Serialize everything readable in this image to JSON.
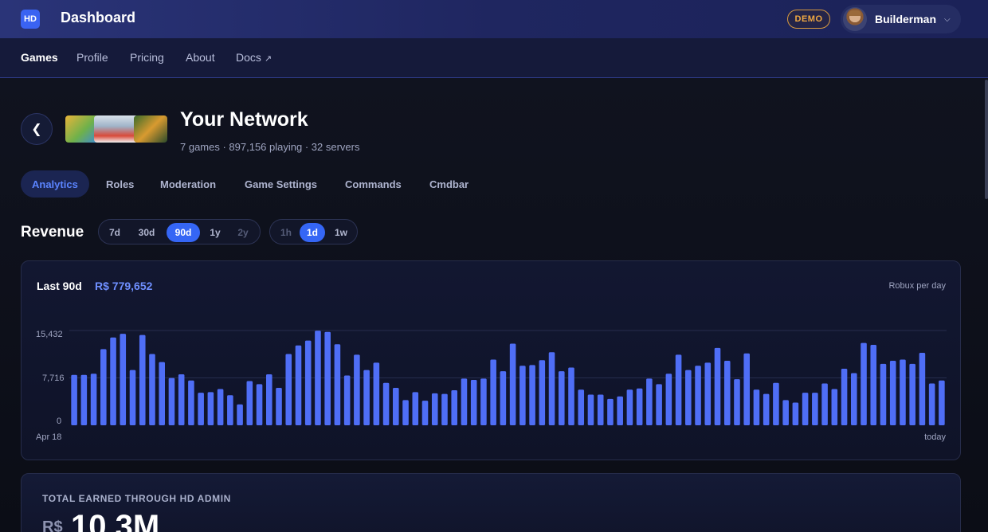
{
  "header": {
    "logo_text": "HD",
    "title": "Dashboard",
    "demo_badge": "DEMO",
    "username": "Builderman"
  },
  "nav": {
    "items": [
      {
        "label": "Games",
        "active": true
      },
      {
        "label": "Profile"
      },
      {
        "label": "Pricing"
      },
      {
        "label": "About"
      },
      {
        "label": "Docs",
        "external": true
      }
    ]
  },
  "network": {
    "title": "Your Network",
    "stats": "7 games · 897,156 playing · 32 servers"
  },
  "tabs": [
    {
      "label": "Analytics",
      "active": true
    },
    {
      "label": "Roles"
    },
    {
      "label": "Moderation"
    },
    {
      "label": "Game Settings"
    },
    {
      "label": "Commands"
    },
    {
      "label": "Cmdbar"
    }
  ],
  "revenue": {
    "title": "Revenue",
    "range_options": [
      {
        "label": "7d"
      },
      {
        "label": "30d"
      },
      {
        "label": "90d",
        "active": true
      },
      {
        "label": "1y"
      },
      {
        "label": "2y",
        "disabled": true
      }
    ],
    "resolution_options": [
      {
        "label": "1h",
        "disabled": true
      },
      {
        "label": "1d",
        "active": true
      },
      {
        "label": "1w"
      }
    ]
  },
  "card": {
    "period_label": "Last 90d",
    "total": "R$ 779,652",
    "unit": "Robux per day"
  },
  "chart_data": {
    "type": "bar",
    "title": "",
    "ylim": [
      0,
      15432
    ],
    "yticks": [
      "15,432",
      "7,716",
      "0"
    ],
    "x_start_label": "Apr 18",
    "x_end_label": "today",
    "grid": true,
    "bar_color": "#4f6ef6",
    "values": [
      8200,
      8200,
      8400,
      12400,
      14300,
      14900,
      9000,
      14700,
      11600,
      10300,
      7700,
      8300,
      7300,
      5300,
      5400,
      5900,
      4900,
      3400,
      7200,
      6700,
      8300,
      6100,
      11600,
      13000,
      13800,
      15400,
      15200,
      13200,
      8100,
      11500,
      9000,
      10200,
      6900,
      6100,
      4100,
      5400,
      4000,
      5200,
      5100,
      5700,
      7600,
      7400,
      7600,
      10700,
      8800,
      13300,
      9700,
      9800,
      10600,
      11900,
      8800,
      9400,
      5800,
      5000,
      5000,
      4300,
      4700,
      5800,
      6000,
      7600,
      6700,
      8400,
      11500,
      9000,
      9700,
      10200,
      12600,
      10500,
      7500,
      11700,
      5800,
      5100,
      6900,
      4100,
      3700,
      5300,
      5300,
      6800,
      5900,
      9200,
      8500,
      13400,
      13100,
      10000,
      10500,
      10700,
      10000,
      11800,
      6800,
      7300
    ]
  },
  "total_card": {
    "label": "TOTAL EARNED THROUGH HD ADMIN",
    "currency": "R$",
    "value": "10.3M"
  }
}
